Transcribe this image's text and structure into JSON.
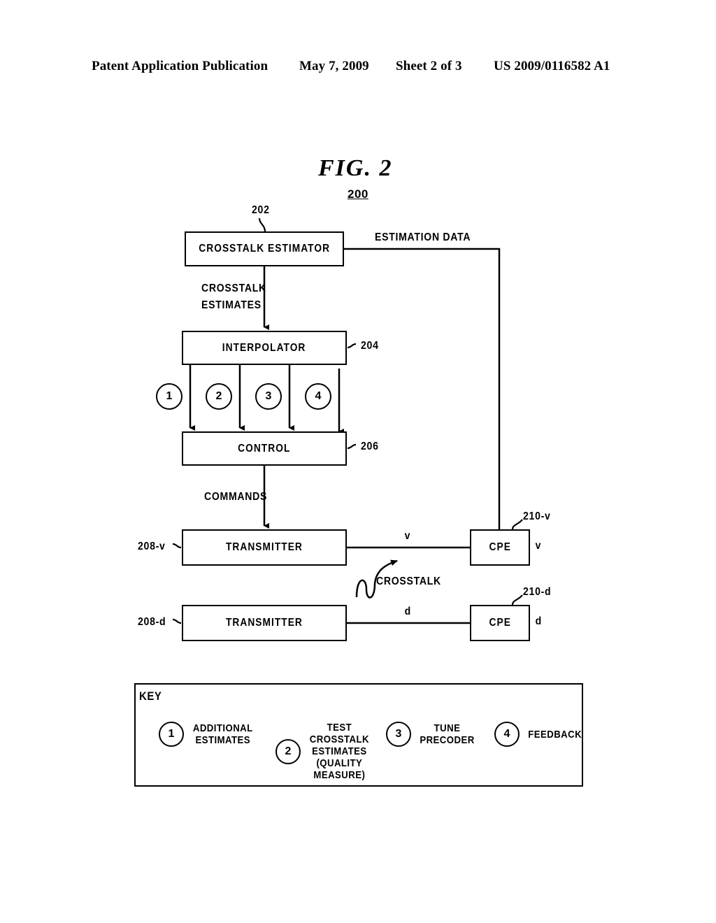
{
  "header": {
    "publication": "Patent Application Publication",
    "date": "May 7, 2009",
    "sheet": "Sheet 2 of 3",
    "patent_number": "US 2009/0116582 A1"
  },
  "figure": {
    "title": "FIG.  2",
    "reference": "200"
  },
  "blocks": {
    "estimator": {
      "label": "CROSSTALK  ESTIMATOR",
      "ref": "202"
    },
    "interpolator": {
      "label": "INTERPOLATOR",
      "ref": "204"
    },
    "control": {
      "label": "CONTROL",
      "ref": "206"
    },
    "transmitter_v": {
      "label": "TRANSMITTER",
      "ref": "208-v"
    },
    "transmitter_d": {
      "label": "TRANSMITTER",
      "ref": "208-d"
    },
    "cpe_v": {
      "label": "CPE",
      "ref": "210-v",
      "line": "v",
      "out": "v"
    },
    "cpe_d": {
      "label": "CPE",
      "ref": "210-d",
      "line": "d",
      "out": "d"
    }
  },
  "signals": {
    "estimation_data": "ESTIMATION  DATA",
    "crosstalk_estimates_line1": "CROSSTALK",
    "crosstalk_estimates_line2": "ESTIMATES",
    "commands": "COMMANDS",
    "crosstalk": "CROSSTALK"
  },
  "flow_markers": [
    {
      "num": "1"
    },
    {
      "num": "2"
    },
    {
      "num": "3"
    },
    {
      "num": "4"
    }
  ],
  "key": {
    "title": "KEY",
    "entries": [
      {
        "num": "1",
        "text": "ADDITIONAL\nESTIMATES"
      },
      {
        "num": "2",
        "text": "TEST\nCROSSTALK\nESTIMATES\n(QUALITY\nMEASURE)"
      },
      {
        "num": "3",
        "text": "TUNE\nPRECODER"
      },
      {
        "num": "4",
        "text": "FEEDBACK"
      }
    ]
  },
  "colors": {
    "ink": "#000000",
    "paper": "#ffffff"
  }
}
